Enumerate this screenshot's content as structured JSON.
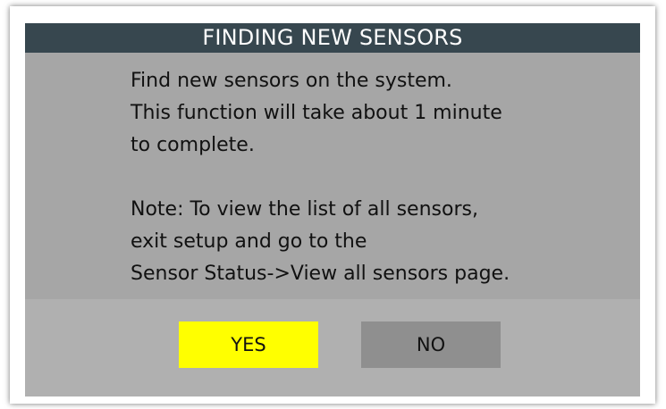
{
  "dialog": {
    "title": "FINDING NEW SENSORS",
    "message_lines": [
      "Find new sensors on the system.",
      "This function will take about 1 minute",
      "to complete.",
      "",
      "Note: To view the list of all sensors,",
      "exit setup and go to the",
      "Sensor Status->View all sensors page."
    ],
    "yes_label": "YES",
    "no_label": "NO"
  },
  "colors": {
    "title_bar": "#37474f",
    "panel": "#a6a6a6",
    "yes_button": "#ffff00",
    "no_button": "#8f8f8f"
  }
}
